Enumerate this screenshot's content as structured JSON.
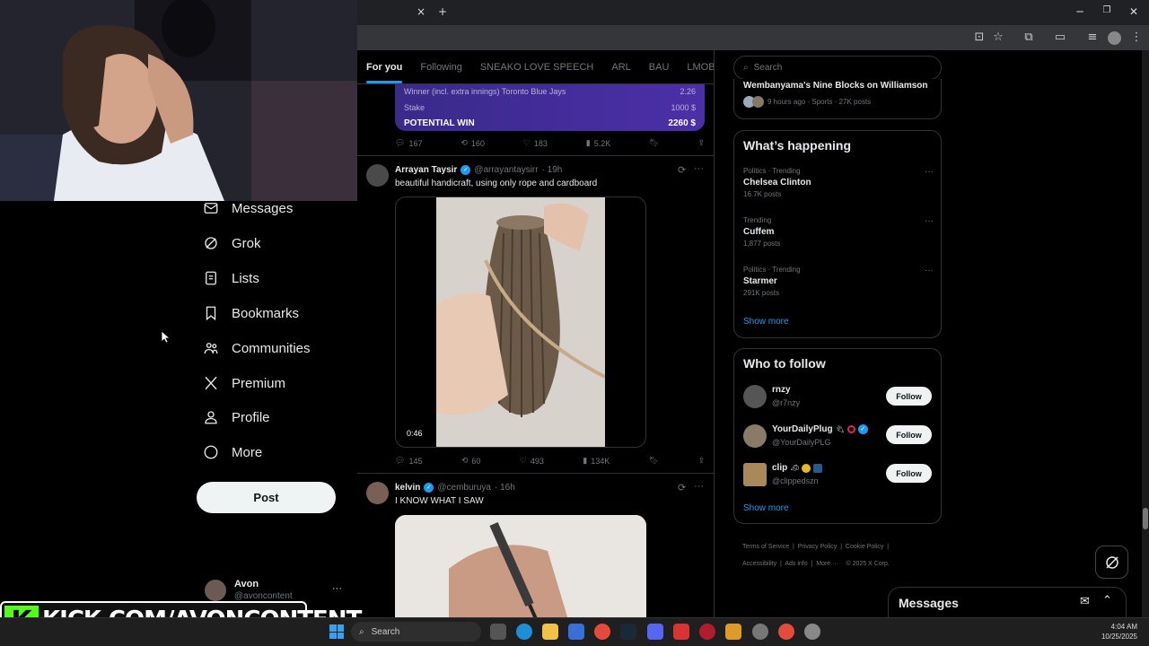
{
  "stream": {
    "banner_url": "KICK.COM/AVONCONTENT",
    "banner_k": "K"
  },
  "browser": {
    "new_tab": "+",
    "close_tab": "×",
    "minimize": "─",
    "restore": "❐",
    "close": "✕"
  },
  "nav": {
    "items": [
      {
        "label": "Messages",
        "icon": "mail-icon"
      },
      {
        "label": "Grok",
        "icon": "grok-icon"
      },
      {
        "label": "Lists",
        "icon": "lists-icon"
      },
      {
        "label": "Bookmarks",
        "icon": "bookmark-icon"
      },
      {
        "label": "Communities",
        "icon": "communities-icon"
      },
      {
        "label": "Premium",
        "icon": "x-logo-icon"
      },
      {
        "label": "Profile",
        "icon": "profile-icon"
      },
      {
        "label": "More",
        "icon": "more-circle-icon"
      }
    ],
    "post_label": "Post",
    "account": {
      "name": "Avon",
      "handle": "@avoncontent",
      "more": "···"
    }
  },
  "feed": {
    "tabs": [
      "For you",
      "Following",
      "SNEAKO LOVE SPEECH",
      "ARL",
      "BAU",
      "LMOB"
    ],
    "bet": {
      "row1_label": "Winner (incl. extra innings) Toronto Blue Jays",
      "row1_value": "2.26",
      "row2_label": "Stake",
      "row2_value": "1000 $",
      "row3_label": "POTENTIAL WIN",
      "row3_value": "2260 $"
    },
    "tweet0_actions": {
      "replies": "167",
      "reposts": "160",
      "likes": "183",
      "views": "5.2K"
    },
    "tweet1": {
      "name": "Arrayan Taysir",
      "handle": "@arrayantaysirr",
      "time": "· 19h",
      "text": "beautiful handicraft, using only rope and cardboard",
      "duration": "0:46",
      "actions": {
        "replies": "145",
        "reposts": "60",
        "likes": "493",
        "views": "134K"
      }
    },
    "tweet2": {
      "name": "kelvin",
      "handle": "@cemburuya",
      "time": "· 16h",
      "text": "I KNOW WHAT I SAW"
    }
  },
  "right": {
    "search_placeholder": "Search",
    "top_story": {
      "title": "Wembanyama's Nine Blocks on Williamson",
      "meta": "9 hours ago · Sports · 27K posts"
    },
    "whats_happening": {
      "title": "What’s happening",
      "trends": [
        {
          "meta": "Politics · Trending",
          "name": "Chelsea Clinton",
          "posts": "16.7K posts"
        },
        {
          "meta": "Trending",
          "name": "Cuffem",
          "posts": "1,877 posts"
        },
        {
          "meta": "Politics · Trending",
          "name": "Starmer",
          "posts": "291K posts"
        }
      ],
      "show_more": "Show more"
    },
    "who_to_follow": {
      "title": "Who to follow",
      "users": [
        {
          "name": "rnzy",
          "handle": "@r7nzy"
        },
        {
          "name": "YourDailyPlug",
          "handle": "@YourDailyPLG"
        },
        {
          "name": "clip",
          "handle": "@clippedszn"
        }
      ],
      "follow_label": "Follow",
      "show_more": "Show more"
    },
    "footer": {
      "terms": "Terms of Service",
      "privacy": "Privacy Policy",
      "cookie": "Cookie Policy",
      "accessibility": "Accessibility",
      "ads": "Ads info",
      "more": "More ···",
      "copyright": "© 2025 X Corp."
    },
    "messages_title": "Messages"
  },
  "taskbar": {
    "search": "Search",
    "time": "4:04 AM",
    "date": "10/25/2025"
  }
}
